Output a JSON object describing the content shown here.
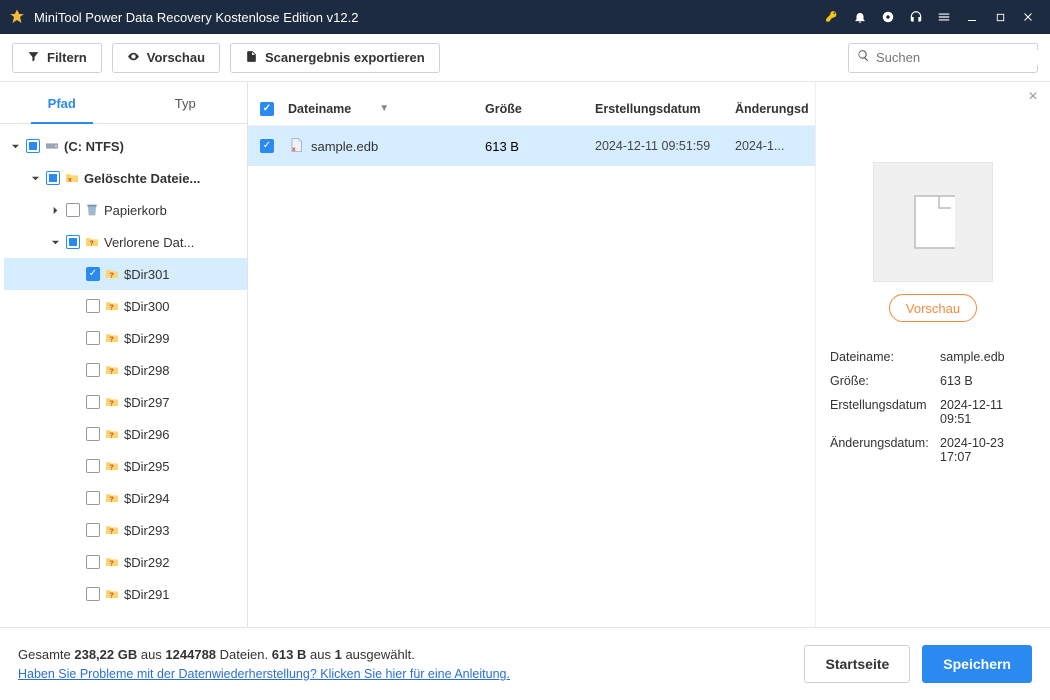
{
  "titlebar": {
    "title": "MiniTool Power Data Recovery Kostenlose Edition v12.2"
  },
  "toolbar": {
    "filter": "Filtern",
    "preview": "Vorschau",
    "export": "Scanergebnis exportieren",
    "search_placeholder": "Suchen"
  },
  "tabs": {
    "path": "Pfad",
    "type": "Typ"
  },
  "tree": {
    "root": "(C: NTFS)",
    "deleted": "Gelöschte Dateie...",
    "recycle": "Papierkorb",
    "lost": "Verlorene Dat...",
    "dirs": [
      "$Dir301",
      "$Dir300",
      "$Dir299",
      "$Dir298",
      "$Dir297",
      "$Dir296",
      "$Dir295",
      "$Dir294",
      "$Dir293",
      "$Dir292",
      "$Dir291"
    ]
  },
  "columns": {
    "name": "Dateiname",
    "size": "Größe",
    "created": "Erstellungsdatum",
    "modified": "Änderungsd"
  },
  "files": [
    {
      "name": "sample.edb",
      "size": "613 B",
      "created": "2024-12-11 09:51:59",
      "modified": "2024-1..."
    }
  ],
  "preview": {
    "button": "Vorschau",
    "labels": {
      "name": "Dateiname:",
      "size": "Größe:",
      "created": "Erstellungsdatum",
      "modified": "Änderungsdatum:"
    },
    "values": {
      "name": "sample.edb",
      "size": "613 B",
      "created": "2024-12-11 09:51",
      "modified": "2024-10-23 17:07"
    }
  },
  "footer": {
    "total_prefix": "Gesamte ",
    "total_gb": "238,22 GB",
    "total_mid": " aus ",
    "total_files": "1244788",
    "total_suffix": " Dateien.  ",
    "sel_size": "613 B",
    "sel_mid": " aus ",
    "sel_count": "1",
    "sel_suffix": " ausgewählt.",
    "help_link": "Haben Sie Probleme mit der Datenwiederherstellung? Klicken Sie hier für eine Anleitung.",
    "home": "Startseite",
    "save": "Speichern"
  }
}
